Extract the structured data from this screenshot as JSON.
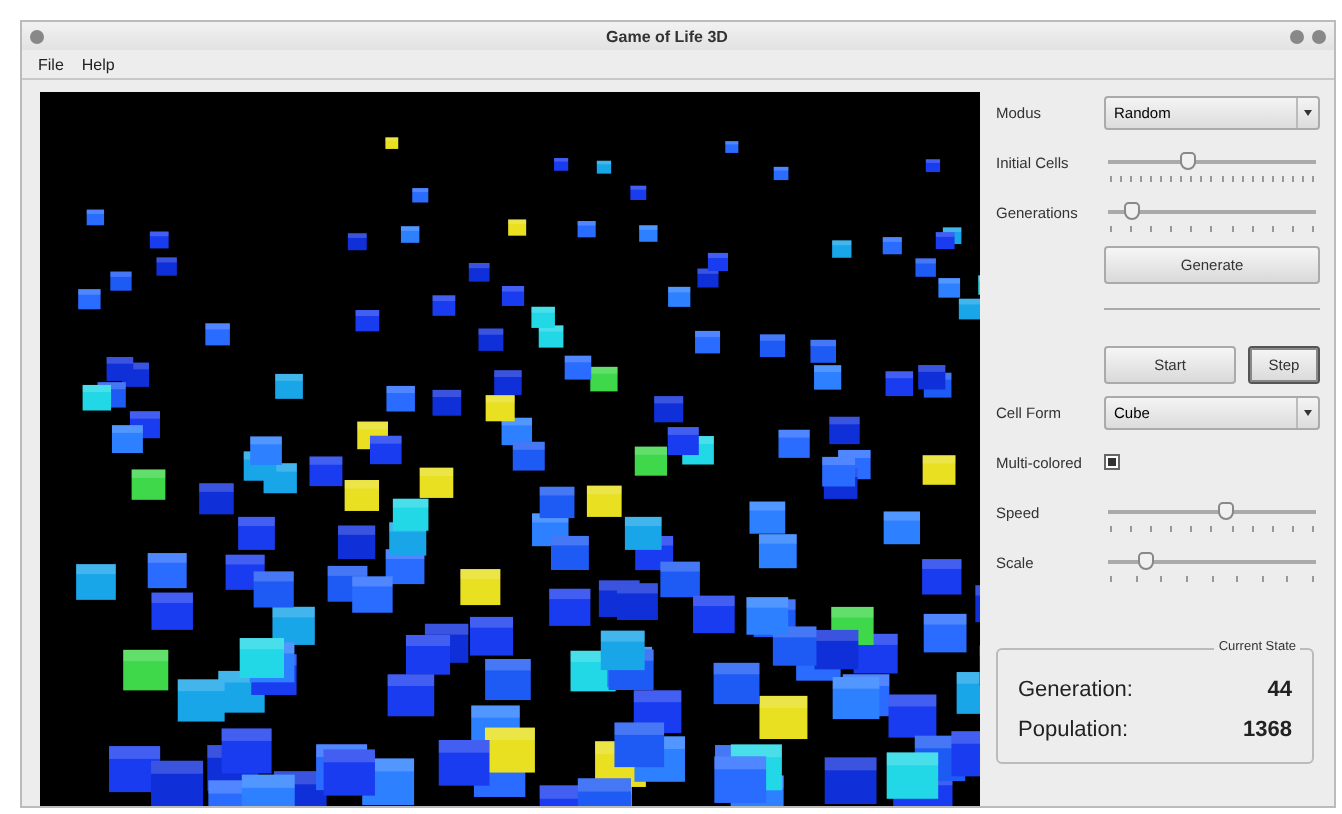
{
  "window": {
    "title": "Game of Life 3D"
  },
  "menu": [
    "File",
    "Help"
  ],
  "controls": [
    {
      "kind": "dropdown",
      "label": "Modus",
      "value": "Random"
    },
    {
      "kind": "slider",
      "label": "Initial Cells",
      "level": 0.38
    },
    {
      "kind": "slider",
      "label": "Generations",
      "level": 0.12
    },
    {
      "kind": "button",
      "label": "Generate"
    },
    {
      "kind": "separator"
    },
    {
      "kind": "buttons",
      "buttons": [
        {
          "label": "Start",
          "focused": false
        },
        {
          "label": "Step",
          "focused": true
        }
      ]
    },
    {
      "kind": "dropdown",
      "label": "Cell Form",
      "value": "Cube"
    },
    {
      "kind": "checkbox",
      "label": "Multi-colored",
      "checked": true
    },
    {
      "kind": "slider",
      "label": "Speed",
      "level": 0.57
    },
    {
      "kind": "slider",
      "label": "Scale",
      "level": 0.18
    }
  ],
  "current_state": {
    "title": "Current State",
    "rows": [
      {
        "label": "Generation:",
        "value": "44"
      },
      {
        "label": "Population:",
        "value": "1368"
      }
    ]
  }
}
